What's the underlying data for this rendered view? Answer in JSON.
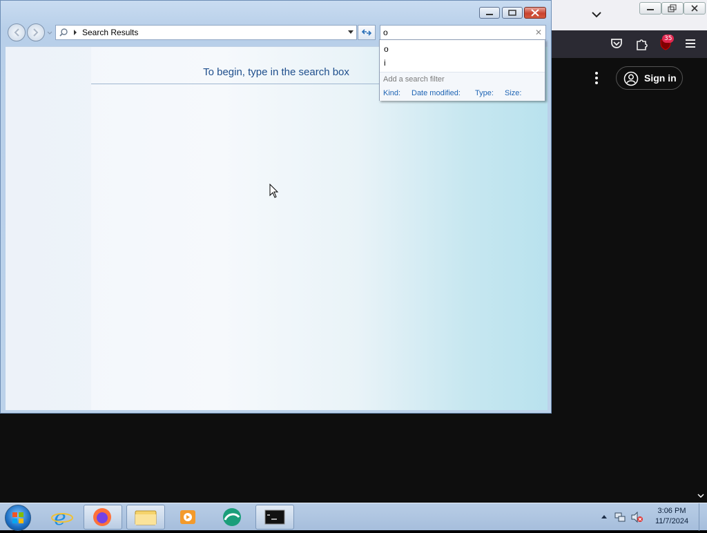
{
  "browser": {
    "badge_count": "35",
    "sign_in_label": "Sign in"
  },
  "explorer": {
    "address": "Search Results",
    "search_value": "o",
    "hint": "To begin, type in the search box",
    "suggestions": [
      "o",
      "i"
    ],
    "filter_title": "Add a search filter",
    "filters": [
      "Kind:",
      "Date modified:",
      "Type:",
      "Size:"
    ]
  },
  "taskbar": {
    "items": [
      "internet-explorer",
      "firefox",
      "file-explorer",
      "media-player",
      "browser-app",
      "command-prompt"
    ],
    "time": "3:06 PM",
    "date": "11/7/2024"
  }
}
